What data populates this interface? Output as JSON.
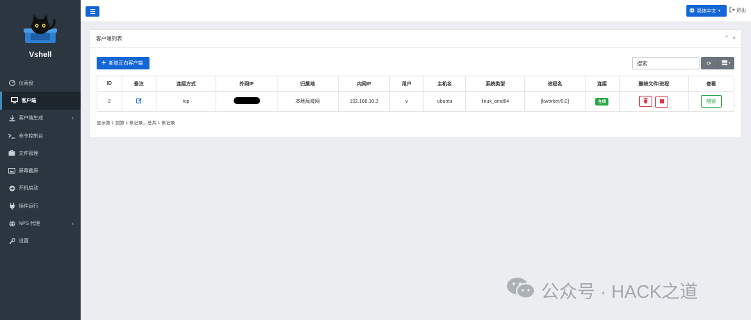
{
  "sidebar": {
    "brand": "Vshell",
    "items": [
      {
        "label": "仪表盘",
        "icon": "dashboard-icon",
        "active": false,
        "chevron": false
      },
      {
        "label": "客户端",
        "icon": "desktop-icon",
        "active": true,
        "chevron": false
      },
      {
        "label": "客户端生成",
        "icon": "download-icon",
        "active": false,
        "chevron": true
      },
      {
        "label": "命令控制台",
        "icon": "terminal-icon",
        "active": false,
        "chevron": false
      },
      {
        "label": "文件管理",
        "icon": "briefcase-icon",
        "active": false,
        "chevron": false
      },
      {
        "label": "屏幕截屏",
        "icon": "image-icon",
        "active": false,
        "chevron": false
      },
      {
        "label": "开机启动",
        "icon": "plus-circle-icon",
        "active": false,
        "chevron": false
      },
      {
        "label": "插件运行",
        "icon": "plug-icon",
        "active": false,
        "chevron": false
      },
      {
        "label": "NPS 代理",
        "icon": "globe-icon",
        "active": false,
        "chevron": true
      },
      {
        "label": "设置",
        "icon": "wrench-icon",
        "active": false,
        "chevron": false
      }
    ]
  },
  "topbar": {
    "language": "简体中文",
    "logout": "退出"
  },
  "card": {
    "title": "客户端列表",
    "new_button": "新增正向客户端",
    "search_placeholder": "搜索",
    "columns": [
      "ID",
      "备注",
      "连接方式",
      "外网IP",
      "归属地",
      "内网IP",
      "用户",
      "主机名",
      "系统类型",
      "进程名",
      "连接",
      "删除文件/进程",
      "查看"
    ],
    "row": {
      "id": "2",
      "conn_method": "tcp",
      "location": "本地局域网",
      "internal_ip": "192.168.10.3",
      "user": "v",
      "hostname": "ubuntu",
      "os_type": "linux_amd64",
      "process": "[kworker/0:2]",
      "status": "在线",
      "view": "隧道"
    },
    "footer": "显示第 1 到第 1 条记录，总共 1 条记录"
  },
  "watermark": {
    "text": "公众号 · HACK之道"
  },
  "colors": {
    "sidebar_bg": "#2b3640",
    "primary": "#1366d6",
    "success": "#28a745",
    "danger": "#dc3545"
  }
}
